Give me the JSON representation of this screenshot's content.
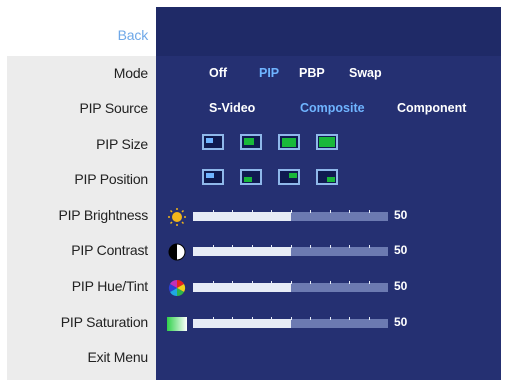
{
  "menu": {
    "items": [
      {
        "id": "back",
        "label": "Back"
      },
      {
        "id": "mode",
        "label": "Mode"
      },
      {
        "id": "pip-source",
        "label": "PIP Source"
      },
      {
        "id": "pip-size",
        "label": "PIP Size"
      },
      {
        "id": "pip-position",
        "label": "PIP Position"
      },
      {
        "id": "pip-brightness",
        "label": "PIP Brightness"
      },
      {
        "id": "pip-contrast",
        "label": "PIP Contrast"
      },
      {
        "id": "pip-hue",
        "label": "PIP Hue/Tint"
      },
      {
        "id": "pip-saturation",
        "label": "PIP Saturation"
      },
      {
        "id": "exit",
        "label": "Exit Menu"
      }
    ]
  },
  "mode": {
    "options": [
      "Off",
      "PIP",
      "PBP",
      "Swap"
    ],
    "selected": "PIP"
  },
  "source": {
    "options": [
      "S-Video",
      "Composite",
      "Component"
    ],
    "selected": "Composite"
  },
  "sliders": {
    "brightness": {
      "value": 50,
      "icon": "sun-icon"
    },
    "contrast": {
      "value": 50,
      "icon": "contrast-icon"
    },
    "hue": {
      "value": 50,
      "icon": "color-wheel-icon"
    },
    "saturation": {
      "value": 50,
      "icon": "saturation-gradient-icon"
    },
    "max": 100
  },
  "colors": {
    "panel": "#253072",
    "selected_text": "#6fb4ff",
    "menu_back": "#ececec",
    "back_label": "#6fa8e8"
  }
}
